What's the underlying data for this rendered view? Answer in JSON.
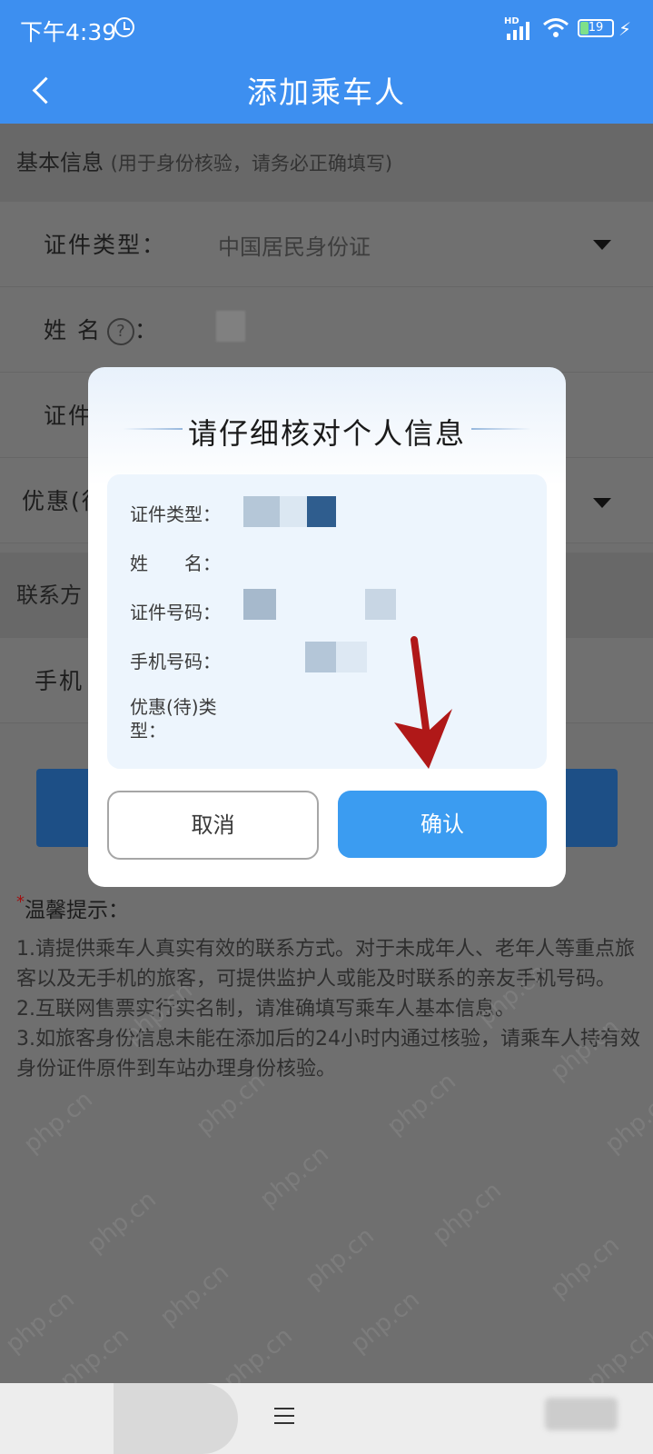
{
  "status_bar": {
    "time": "下午4:39",
    "hd": "HD",
    "battery": "19",
    "bolt": "⚡"
  },
  "header": {
    "title": "添加乘车人"
  },
  "basic_section": {
    "title": "基本信息",
    "hint": "(用于身份核验，请务必正确填写)"
  },
  "rows": {
    "id_type": {
      "label": "证件类型：",
      "value": "中国居民身份证"
    },
    "name": {
      "label": "姓 名",
      "colon": "：",
      "help": "?"
    },
    "id_number": {
      "label": "证件"
    },
    "discount": {
      "label": "优惠(待"
    }
  },
  "contact_section": {
    "title": "联系方"
  },
  "phone_row": {
    "label": "手机"
  },
  "tips": {
    "title": "温馨提示：",
    "star": "*",
    "items": [
      "1.请提供乘车人真实有效的联系方式。对于未成年人、老年人等重点旅客以及无手机的旅客，可提供监护人或能及时联系的亲友手机号码。",
      "2.互联网售票实行实名制，请准确填写乘车人基本信息。",
      "3.如旅客身份信息未能在添加后的24小时内通过核验，请乘车人持有效身份证件原件到车站办理身份核验。"
    ]
  },
  "dialog": {
    "title": "请仔细核对个人信息",
    "fields": {
      "id_type": "证件类型：",
      "name": "姓　　名：",
      "id_number": "证件号码：",
      "phone": "手机号码：",
      "discount_line1": "优惠(待)类",
      "discount_line2": "型："
    },
    "cancel": "取消",
    "confirm": "确认"
  },
  "watermark": "php.cn",
  "colors": {
    "brand_blue": "#3d8ff0",
    "confirm_blue": "#3b9cf1",
    "arrow_red": "#b01818"
  }
}
